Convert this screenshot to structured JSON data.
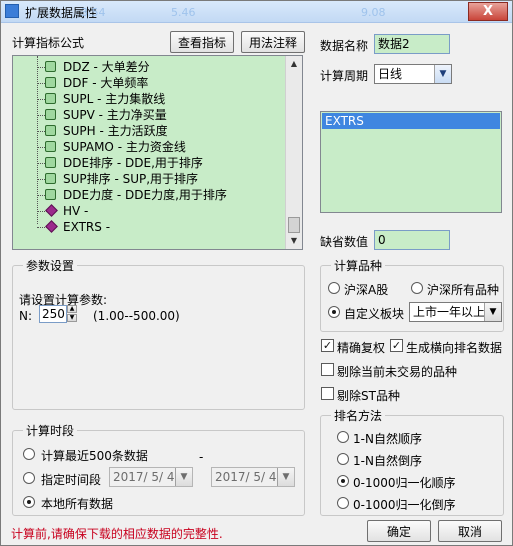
{
  "window": {
    "title": "扩展数据属性",
    "close_symbol": "X",
    "background_watermark": [
      "3.54",
      "5.46",
      "9.08"
    ]
  },
  "formula": {
    "label": "计算指标公式",
    "view_button": "查看指标",
    "usage_button": "用法注释",
    "items": [
      "DDZ - 大单差分",
      "DDF - 大单频率",
      "SUPL - 主力集散线",
      "SUPV - 主力净买量",
      "SUPH - 主力活跃度",
      "SUPAMO - 主力资金线",
      "DDE排序 - DDE,用于排序",
      "SUP排序 - SUP,用于排序",
      "DDE力度 - DDE力度,用于排序",
      "HV -",
      "EXTRS -"
    ]
  },
  "data_name": {
    "label": "数据名称",
    "value": "数据2"
  },
  "period": {
    "label": "计算周期",
    "value": "日线"
  },
  "selected_formula_box": {
    "value": "EXTRS"
  },
  "default_value": {
    "label": "缺省数值",
    "value": "0"
  },
  "params": {
    "group_title": "参数设置",
    "prompt": "请设置计算参数:",
    "n_label": "N:",
    "n_value": "250",
    "range": "(1.00--500.00)"
  },
  "variety": {
    "group_title": "计算品种",
    "opt_a": "沪深A股",
    "opt_all": "沪深所有品种",
    "opt_custom": "自定义板块",
    "custom_value": "上市一年以上"
  },
  "checks": {
    "precise_rights": "精确复权",
    "cross_rank": "生成横向排名数据",
    "exclude_untraded": "剔除当前未交易的品种",
    "exclude_st": "剔除ST品种"
  },
  "period_group": {
    "group_title": "计算时段",
    "opt_recent": "计算最近500条数据",
    "opt_range": "指定时间段",
    "date_from": "2017/ 5/ 4",
    "date_to": "2017/ 5/ 4",
    "dash": "-",
    "opt_local": "本地所有数据"
  },
  "rank": {
    "group_title": "排名方法",
    "opt1": "1-N自然顺序",
    "opt2": "1-N自然倒序",
    "opt3": "0-1000归一化顺序",
    "opt4": "0-1000归一化倒序"
  },
  "footer": {
    "warning": "计算前,请确保下载的相应数据的完整性.",
    "ok": "确定",
    "cancel": "取消"
  },
  "colors": {
    "list_bg": "#c8ecc8",
    "selection_blue": "#3f86e0",
    "warning_red": "#c8001e"
  }
}
